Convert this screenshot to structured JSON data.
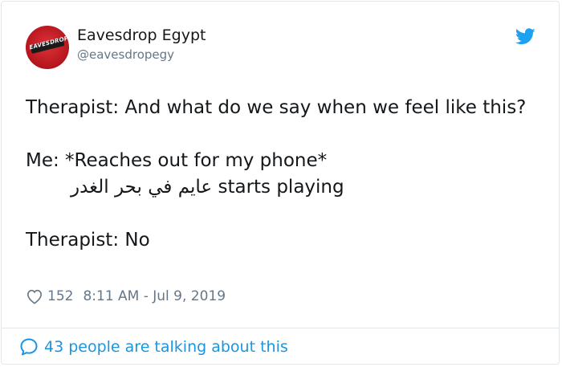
{
  "colors": {
    "text": "#14171a",
    "secondary": "#657786",
    "link": "#1b95e0",
    "border": "#e1e8ed",
    "avatar": "#c41a22"
  },
  "author": {
    "avatar_icon": "eavesdrop-logo-icon",
    "avatar_text": "EAVESDROP",
    "display_name": "Eavesdrop Egypt",
    "handle": "@eavesdropegy"
  },
  "brand_icon": "twitter-bird-icon",
  "tweet": {
    "line1": "Therapist: And what do we say when we feel like this?",
    "line2": "Me: *Reaches out for my phone*",
    "line3": "عايم في بحر الغدر starts playing",
    "line4": "Therapist: No"
  },
  "meta": {
    "like_icon": "heart-icon",
    "likes": "152",
    "timestamp": "8:11 AM - Jul 9, 2019"
  },
  "footer": {
    "icon": "speech-bubble-icon",
    "talking": "43 people are talking about this"
  }
}
